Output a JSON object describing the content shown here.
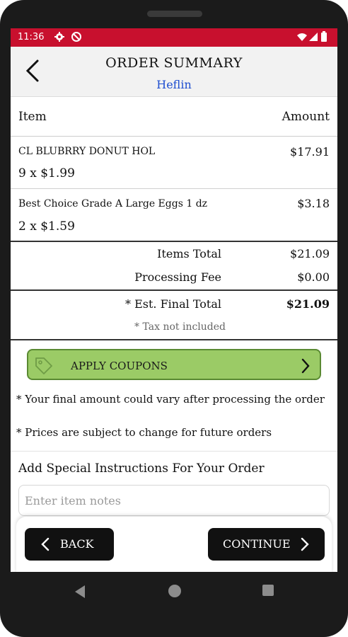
{
  "status_bar": {
    "time": "11:36"
  },
  "header": {
    "title": "ORDER SUMMARY",
    "subtitle": "Heflin"
  },
  "table": {
    "col_item": "Item",
    "col_amount": "Amount",
    "rows": [
      {
        "name": "CL BLUBRRY DONUT HOL",
        "qty": "9 x $1.99",
        "amount": "$17.91"
      },
      {
        "name": "Best Choice Grade A Large Eggs 1 dz",
        "qty": "2 x $1.59",
        "amount": "$3.18"
      }
    ]
  },
  "totals": {
    "items_total_label": "Items Total",
    "items_total_value": "$21.09",
    "processing_fee_label": "Processing Fee",
    "processing_fee_value": "$0.00",
    "final_total_label": "* Est. Final Total",
    "final_total_value": "$21.09",
    "tax_note": "* Tax not included"
  },
  "coupon": {
    "label": "APPLY COUPONS",
    "accent": "#9bcb66"
  },
  "notes": {
    "line1": "* Your final amount could vary after processing the order",
    "line2": "* Prices are subject to change for future orders"
  },
  "instructions": {
    "title": "Add Special Instructions For Your Order",
    "placeholder": "Enter item notes"
  },
  "footer": {
    "back_label": "BACK",
    "continue_label": "CONTINUE"
  },
  "colors": {
    "status_bar": "#c8102e",
    "subtitle": "#1f4fd0"
  },
  "icons": [
    "settings-icon",
    "do-not-disturb-icon",
    "wifi-icon",
    "signal-icon",
    "battery-icon",
    "back-arrow-icon",
    "tag-icon",
    "chevron-right-icon",
    "chevron-left-icon"
  ]
}
